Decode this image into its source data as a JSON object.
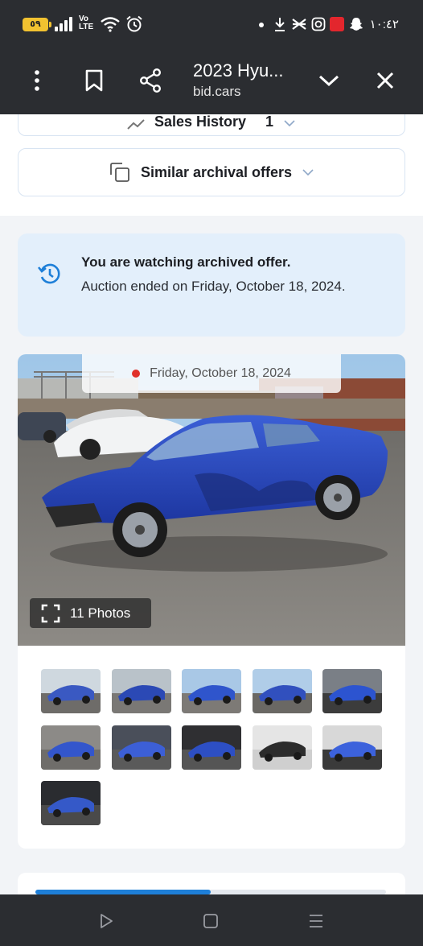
{
  "status_bar": {
    "battery_level": "٥٩",
    "network": "Vo LTE",
    "time": "١٠:٤٢",
    "left_icons": [
      "battery-icon",
      "signal-icon",
      "volte-icon",
      "wifi-icon",
      "alarm-icon"
    ],
    "right_icons": [
      "dot-icon",
      "download-icon",
      "bag-icon",
      "instagram-icon",
      "app-icon",
      "snapchat-icon"
    ],
    "colors": {
      "background": "#2b2d31",
      "battery": "#f2c230"
    }
  },
  "browser": {
    "title": "2023 Hyu...",
    "url": "bid.cars",
    "icons": [
      "more-vert-icon",
      "bookmark-icon",
      "share-icon",
      "chevron-down-icon",
      "close-icon"
    ]
  },
  "page": {
    "sales_history": {
      "label": "Sales History",
      "count": "1"
    },
    "similar_offers": {
      "label": "Similar archival offers"
    },
    "archive_notice": {
      "heading": "You are watching archived offer.",
      "text": "Auction ended on Friday, October 18, 2024."
    },
    "gallery": {
      "date": "Friday, October 18, 2024",
      "photos_label": "11 Photos",
      "photos_count": 11,
      "thumbnails": [
        "car-thumbnail",
        "car-thumbnail",
        "car-thumbnail",
        "car-thumbnail",
        "car-thumbnail",
        "car-thumbnail",
        "car-thumbnail",
        "car-thumbnail",
        "car-thumbnail",
        "car-thumbnail",
        "car-thumbnail"
      ]
    },
    "progress_fraction": 0.5,
    "colors": {
      "accent": "#1e7fd8",
      "notice_bg": "#e3effb",
      "car": "#2a49b8",
      "live_dot": "#e0302a"
    }
  },
  "navbar": {
    "icons": [
      "back-icon",
      "home-icon",
      "recents-icon"
    ]
  }
}
